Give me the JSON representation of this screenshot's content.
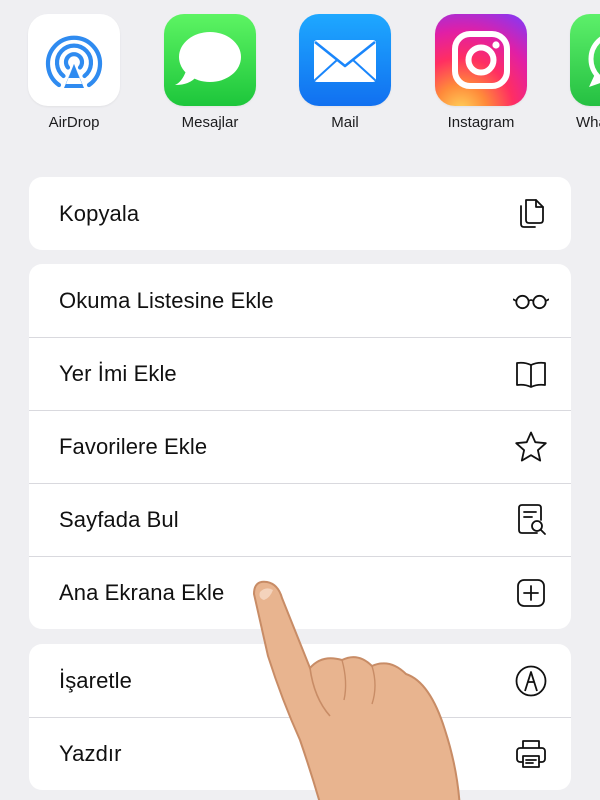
{
  "apps": [
    {
      "label": "AirDrop",
      "icon": "airdrop-icon"
    },
    {
      "label": "Mesajlar",
      "icon": "messages-icon"
    },
    {
      "label": "Mail",
      "icon": "mail-icon"
    },
    {
      "label": "Instagram",
      "icon": "instagram-icon"
    },
    {
      "label": "Wha",
      "icon": "whatsapp-icon"
    }
  ],
  "actions": {
    "group1": [
      {
        "label": "Kopyala",
        "icon": "copy-icon"
      }
    ],
    "group2": [
      {
        "label": "Okuma Listesine Ekle",
        "icon": "glasses-icon"
      },
      {
        "label": "Yer İmi Ekle",
        "icon": "book-icon"
      },
      {
        "label": "Favorilere Ekle",
        "icon": "star-icon"
      },
      {
        "label": "Sayfada Bul",
        "icon": "find-in-page-icon"
      },
      {
        "label": "Ana Ekrana Ekle",
        "icon": "add-square-icon"
      }
    ],
    "group3": [
      {
        "label": "İşaretle",
        "icon": "markup-icon"
      },
      {
        "label": "Yazdır",
        "icon": "printer-icon"
      }
    ]
  },
  "colors": {
    "background": "#efeff2",
    "row_background": "#ffffff",
    "separator": "#d9d9de",
    "airdrop_blue": "#2f8bf0",
    "messages_green": "#2fd24a",
    "mail_blue": "#1a86fb"
  }
}
